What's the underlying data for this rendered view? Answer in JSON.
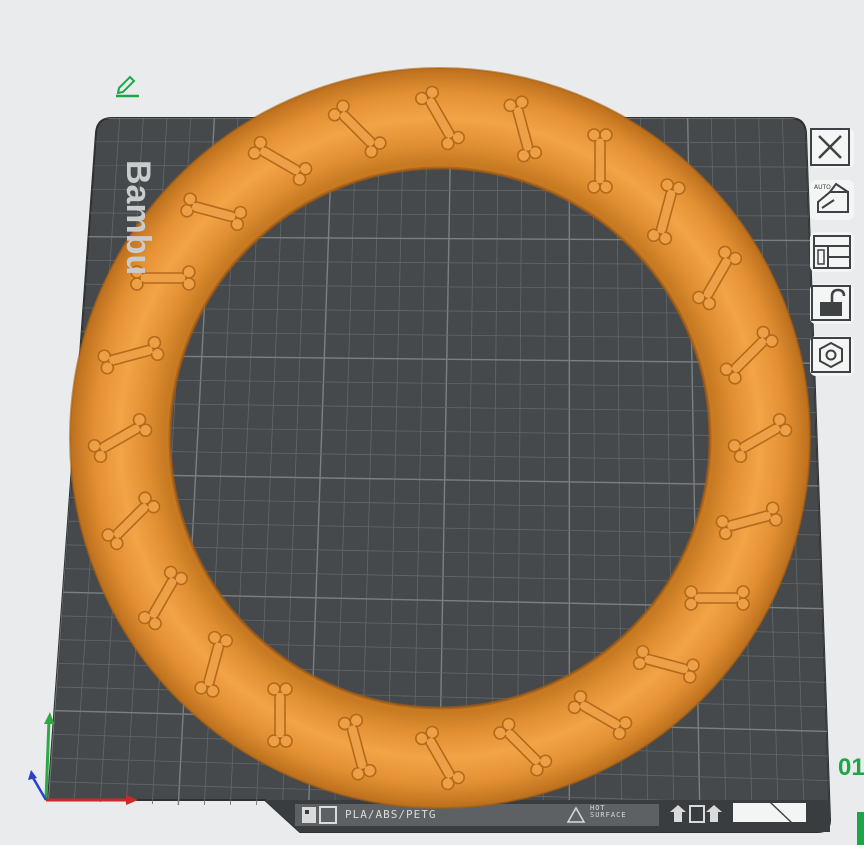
{
  "plate": {
    "brand_text": "Bambu",
    "filament_label": "PLA/ABS/PETG",
    "hot_surface_line1": "HOT",
    "hot_surface_line2": "SURFACE"
  },
  "model": {
    "color": "#f0a044",
    "bone_count": 24
  },
  "toolbar": {
    "buttons": [
      {
        "name": "close-icon"
      },
      {
        "name": "auto-orient-icon",
        "badge": "AUTO"
      },
      {
        "name": "arrange-icon"
      },
      {
        "name": "unlock-icon"
      },
      {
        "name": "plate-settings-icon"
      }
    ]
  },
  "status": {
    "corner_number": "01"
  },
  "colors": {
    "plate": "#4a4e50",
    "grid": "#6c7173",
    "accent_green": "#19a74a",
    "axis_x": "#cc2a2a",
    "axis_y": "#2fa844",
    "axis_z": "#2a40c8"
  }
}
